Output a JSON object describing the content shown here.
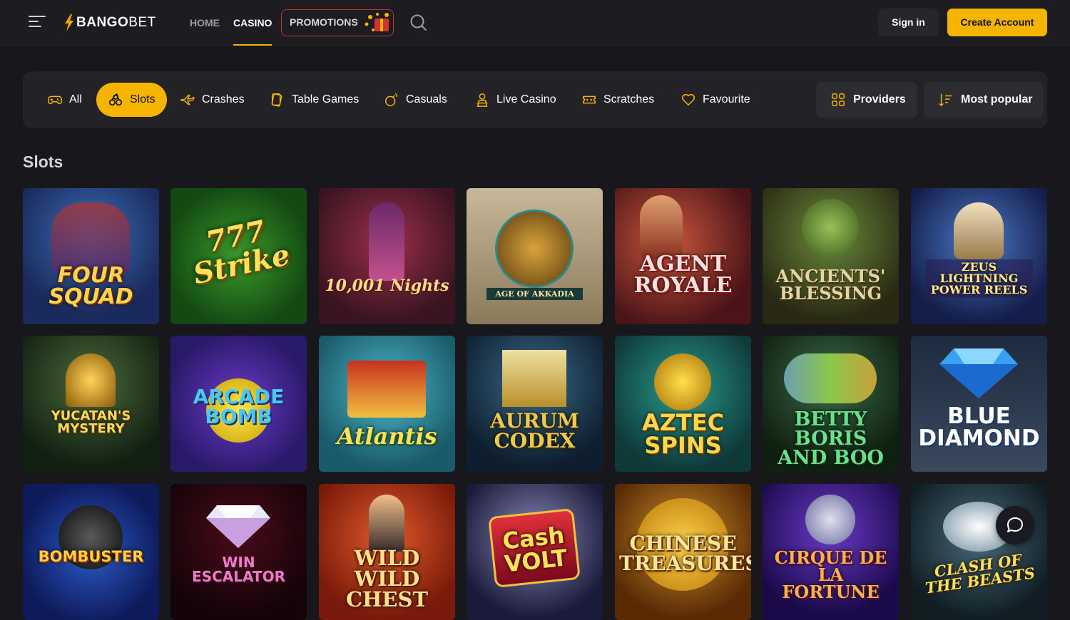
{
  "header": {
    "logo": {
      "part1": "BANGO",
      "part2": "BET"
    },
    "nav": [
      {
        "label": "HOME",
        "active": false
      },
      {
        "label": "CASINO",
        "active": true
      }
    ],
    "promotions_label": "PROMOTIONS",
    "sign_in_label": "Sign in",
    "create_account_label": "Create Account"
  },
  "categories": [
    {
      "label": "All",
      "icon": "gamepad-icon",
      "active": false
    },
    {
      "label": "Slots",
      "icon": "cherries-icon",
      "active": true
    },
    {
      "label": "Crashes",
      "icon": "plane-icon",
      "active": false
    },
    {
      "label": "Table Games",
      "icon": "cards-icon",
      "active": false
    },
    {
      "label": "Casuals",
      "icon": "bomb-icon",
      "active": false
    },
    {
      "label": "Live Casino",
      "icon": "dealer-icon",
      "active": false
    },
    {
      "label": "Scratches",
      "icon": "ticket-icon",
      "active": false
    },
    {
      "label": "Favourite",
      "icon": "heart-icon",
      "active": false
    }
  ],
  "controls": {
    "providers_label": "Providers",
    "sort_label": "Most popular"
  },
  "section": {
    "title": "Slots"
  },
  "games": [
    {
      "title": "FOUR SQUAD"
    },
    {
      "title": "777 Strike"
    },
    {
      "title": "10,001 Nights"
    },
    {
      "title": "AGE OF AKKADIA"
    },
    {
      "title": "AGENT ROYALE"
    },
    {
      "title": "ANCIENTS' BLESSING"
    },
    {
      "title": "ZEUS LIGHTNING POWER REELS"
    },
    {
      "title": "YUCATAN'S MYSTERY"
    },
    {
      "title": "ARCADE BOMB"
    },
    {
      "title": "Atlantis"
    },
    {
      "title": "AURUM CODEX"
    },
    {
      "title": "AZTEC SPINS"
    },
    {
      "title": "BETTY BORIS AND BOO"
    },
    {
      "title": "BLUE DIAMOND"
    },
    {
      "title": "BOMBUSTER"
    },
    {
      "title": "WIN ESCALATOR"
    },
    {
      "title": "WILD WILD CHEST"
    },
    {
      "title": "Cash VOLT"
    },
    {
      "title": "CHINESE TREASURES"
    },
    {
      "title": "CIRQUE DE LA FORTUNE"
    },
    {
      "title": "CLASH OF THE BEASTS"
    }
  ],
  "colors": {
    "accent": "#f5b400",
    "promo_border": "#c2342f",
    "background": "#18181c",
    "panel": "#222227"
  }
}
